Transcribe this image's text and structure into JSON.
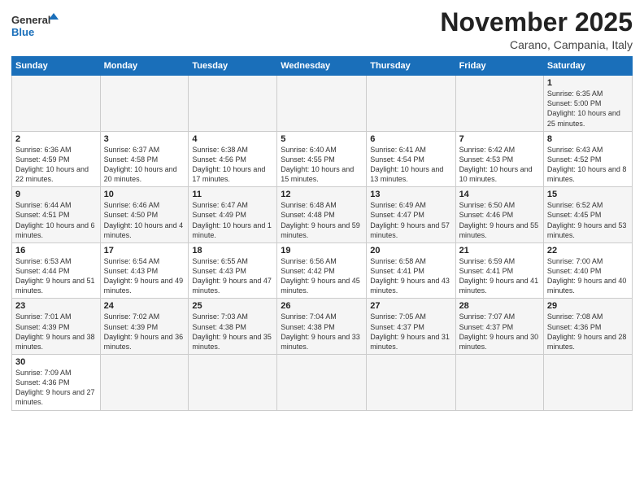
{
  "logo": {
    "text_general": "General",
    "text_blue": "Blue"
  },
  "header": {
    "month": "November 2025",
    "location": "Carano, Campania, Italy"
  },
  "weekdays": [
    "Sunday",
    "Monday",
    "Tuesday",
    "Wednesday",
    "Thursday",
    "Friday",
    "Saturday"
  ],
  "weeks": [
    [
      {
        "day": "",
        "info": ""
      },
      {
        "day": "",
        "info": ""
      },
      {
        "day": "",
        "info": ""
      },
      {
        "day": "",
        "info": ""
      },
      {
        "day": "",
        "info": ""
      },
      {
        "day": "",
        "info": ""
      },
      {
        "day": "1",
        "info": "Sunrise: 6:35 AM\nSunset: 5:00 PM\nDaylight: 10 hours and 25 minutes."
      }
    ],
    [
      {
        "day": "2",
        "info": "Sunrise: 6:36 AM\nSunset: 4:59 PM\nDaylight: 10 hours and 22 minutes."
      },
      {
        "day": "3",
        "info": "Sunrise: 6:37 AM\nSunset: 4:58 PM\nDaylight: 10 hours and 20 minutes."
      },
      {
        "day": "4",
        "info": "Sunrise: 6:38 AM\nSunset: 4:56 PM\nDaylight: 10 hours and 17 minutes."
      },
      {
        "day": "5",
        "info": "Sunrise: 6:40 AM\nSunset: 4:55 PM\nDaylight: 10 hours and 15 minutes."
      },
      {
        "day": "6",
        "info": "Sunrise: 6:41 AM\nSunset: 4:54 PM\nDaylight: 10 hours and 13 minutes."
      },
      {
        "day": "7",
        "info": "Sunrise: 6:42 AM\nSunset: 4:53 PM\nDaylight: 10 hours and 10 minutes."
      },
      {
        "day": "8",
        "info": "Sunrise: 6:43 AM\nSunset: 4:52 PM\nDaylight: 10 hours and 8 minutes."
      }
    ],
    [
      {
        "day": "9",
        "info": "Sunrise: 6:44 AM\nSunset: 4:51 PM\nDaylight: 10 hours and 6 minutes."
      },
      {
        "day": "10",
        "info": "Sunrise: 6:46 AM\nSunset: 4:50 PM\nDaylight: 10 hours and 4 minutes."
      },
      {
        "day": "11",
        "info": "Sunrise: 6:47 AM\nSunset: 4:49 PM\nDaylight: 10 hours and 1 minute."
      },
      {
        "day": "12",
        "info": "Sunrise: 6:48 AM\nSunset: 4:48 PM\nDaylight: 9 hours and 59 minutes."
      },
      {
        "day": "13",
        "info": "Sunrise: 6:49 AM\nSunset: 4:47 PM\nDaylight: 9 hours and 57 minutes."
      },
      {
        "day": "14",
        "info": "Sunrise: 6:50 AM\nSunset: 4:46 PM\nDaylight: 9 hours and 55 minutes."
      },
      {
        "day": "15",
        "info": "Sunrise: 6:52 AM\nSunset: 4:45 PM\nDaylight: 9 hours and 53 minutes."
      }
    ],
    [
      {
        "day": "16",
        "info": "Sunrise: 6:53 AM\nSunset: 4:44 PM\nDaylight: 9 hours and 51 minutes."
      },
      {
        "day": "17",
        "info": "Sunrise: 6:54 AM\nSunset: 4:43 PM\nDaylight: 9 hours and 49 minutes."
      },
      {
        "day": "18",
        "info": "Sunrise: 6:55 AM\nSunset: 4:43 PM\nDaylight: 9 hours and 47 minutes."
      },
      {
        "day": "19",
        "info": "Sunrise: 6:56 AM\nSunset: 4:42 PM\nDaylight: 9 hours and 45 minutes."
      },
      {
        "day": "20",
        "info": "Sunrise: 6:58 AM\nSunset: 4:41 PM\nDaylight: 9 hours and 43 minutes."
      },
      {
        "day": "21",
        "info": "Sunrise: 6:59 AM\nSunset: 4:41 PM\nDaylight: 9 hours and 41 minutes."
      },
      {
        "day": "22",
        "info": "Sunrise: 7:00 AM\nSunset: 4:40 PM\nDaylight: 9 hours and 40 minutes."
      }
    ],
    [
      {
        "day": "23",
        "info": "Sunrise: 7:01 AM\nSunset: 4:39 PM\nDaylight: 9 hours and 38 minutes."
      },
      {
        "day": "24",
        "info": "Sunrise: 7:02 AM\nSunset: 4:39 PM\nDaylight: 9 hours and 36 minutes."
      },
      {
        "day": "25",
        "info": "Sunrise: 7:03 AM\nSunset: 4:38 PM\nDaylight: 9 hours and 35 minutes."
      },
      {
        "day": "26",
        "info": "Sunrise: 7:04 AM\nSunset: 4:38 PM\nDaylight: 9 hours and 33 minutes."
      },
      {
        "day": "27",
        "info": "Sunrise: 7:05 AM\nSunset: 4:37 PM\nDaylight: 9 hours and 31 minutes."
      },
      {
        "day": "28",
        "info": "Sunrise: 7:07 AM\nSunset: 4:37 PM\nDaylight: 9 hours and 30 minutes."
      },
      {
        "day": "29",
        "info": "Sunrise: 7:08 AM\nSunset: 4:36 PM\nDaylight: 9 hours and 28 minutes."
      }
    ],
    [
      {
        "day": "30",
        "info": "Sunrise: 7:09 AM\nSunset: 4:36 PM\nDaylight: 9 hours and 27 minutes."
      },
      {
        "day": "",
        "info": ""
      },
      {
        "day": "",
        "info": ""
      },
      {
        "day": "",
        "info": ""
      },
      {
        "day": "",
        "info": ""
      },
      {
        "day": "",
        "info": ""
      },
      {
        "day": "",
        "info": ""
      }
    ]
  ]
}
